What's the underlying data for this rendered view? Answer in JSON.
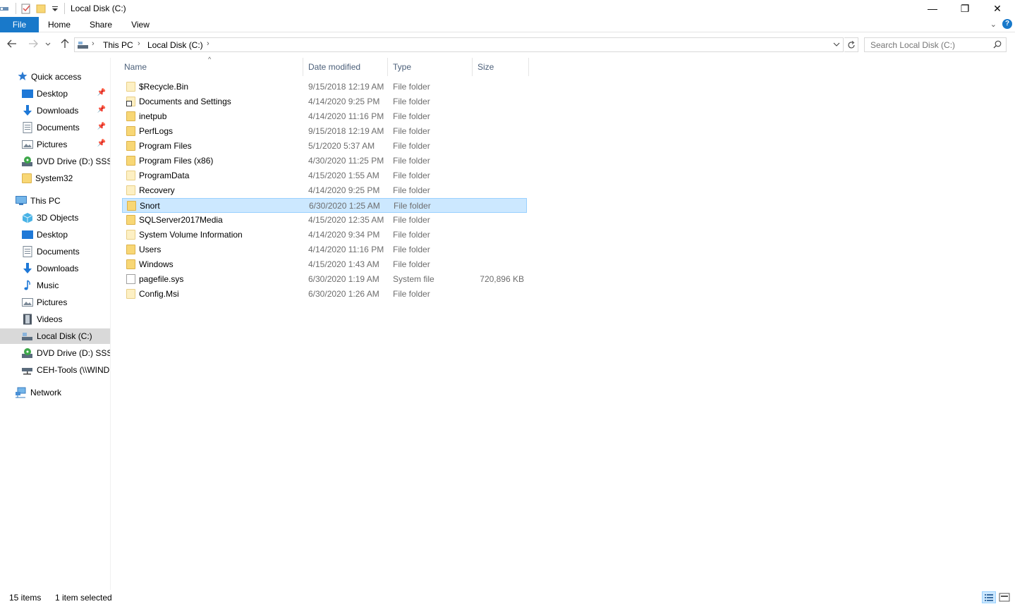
{
  "window": {
    "title": "Local Disk (C:)",
    "minimize_label": "—",
    "maximize_label": "❐",
    "close_label": "✕"
  },
  "ribbon": {
    "tabs": [
      {
        "label": "File"
      },
      {
        "label": "Home"
      },
      {
        "label": "Share"
      },
      {
        "label": "View"
      }
    ],
    "help_label": "?"
  },
  "address": {
    "crumbs": [
      "This PC",
      "Local Disk (C:)"
    ],
    "search_placeholder": "Search Local Disk (C:)"
  },
  "nav": {
    "quick_access": "Quick access",
    "quick_items": [
      {
        "label": "Desktop",
        "pinned": true
      },
      {
        "label": "Downloads",
        "pinned": true
      },
      {
        "label": "Documents",
        "pinned": true
      },
      {
        "label": "Pictures",
        "pinned": true
      },
      {
        "label": "DVD Drive (D:) SSS_X"
      },
      {
        "label": "System32"
      }
    ],
    "this_pc": "This PC",
    "pc_items": [
      {
        "label": "3D Objects"
      },
      {
        "label": "Desktop"
      },
      {
        "label": "Documents"
      },
      {
        "label": "Downloads"
      },
      {
        "label": "Music"
      },
      {
        "label": "Pictures"
      },
      {
        "label": "Videos"
      },
      {
        "label": "Local Disk (C:)",
        "selected": true
      },
      {
        "label": "DVD Drive (D:) SSS_X"
      },
      {
        "label": "CEH-Tools (\\\\WIND"
      }
    ],
    "network": "Network"
  },
  "columns": {
    "name": "Name",
    "date": "Date modified",
    "type": "Type",
    "size": "Size"
  },
  "files": [
    {
      "name": "$Recycle.Bin",
      "date": "9/15/2018 12:19 AM",
      "type": "File folder",
      "size": "",
      "icon": "folder-pale-icon"
    },
    {
      "name": "Documents and Settings",
      "date": "4/14/2020 9:25 PM",
      "type": "File folder",
      "size": "",
      "icon": "folder-shortcut-icon"
    },
    {
      "name": "inetpub",
      "date": "4/14/2020 11:16 PM",
      "type": "File folder",
      "size": "",
      "icon": "folder-icon"
    },
    {
      "name": "PerfLogs",
      "date": "9/15/2018 12:19 AM",
      "type": "File folder",
      "size": "",
      "icon": "folder-icon"
    },
    {
      "name": "Program Files",
      "date": "5/1/2020 5:37 AM",
      "type": "File folder",
      "size": "",
      "icon": "folder-icon"
    },
    {
      "name": "Program Files (x86)",
      "date": "4/30/2020 11:25 PM",
      "type": "File folder",
      "size": "",
      "icon": "folder-icon"
    },
    {
      "name": "ProgramData",
      "date": "4/15/2020 1:55 AM",
      "type": "File folder",
      "size": "",
      "icon": "folder-pale-icon"
    },
    {
      "name": "Recovery",
      "date": "4/14/2020 9:25 PM",
      "type": "File folder",
      "size": "",
      "icon": "folder-pale-icon"
    },
    {
      "name": "Snort",
      "date": "6/30/2020 1:25 AM",
      "type": "File folder",
      "size": "",
      "icon": "folder-icon",
      "selected": true
    },
    {
      "name": "SQLServer2017Media",
      "date": "4/15/2020 12:35 AM",
      "type": "File folder",
      "size": "",
      "icon": "folder-icon"
    },
    {
      "name": "System Volume Information",
      "date": "4/14/2020 9:34 PM",
      "type": "File folder",
      "size": "",
      "icon": "folder-pale-icon"
    },
    {
      "name": "Users",
      "date": "4/14/2020 11:16 PM",
      "type": "File folder",
      "size": "",
      "icon": "folder-icon"
    },
    {
      "name": "Windows",
      "date": "4/15/2020 1:43 AM",
      "type": "File folder",
      "size": "",
      "icon": "folder-icon"
    },
    {
      "name": "pagefile.sys",
      "date": "6/30/2020 1:19 AM",
      "type": "System file",
      "size": "720,896 KB",
      "icon": "file-icon"
    },
    {
      "name": "Config.Msi",
      "date": "6/30/2020 1:26 AM",
      "type": "File folder",
      "size": "",
      "icon": "folder-pale-icon"
    }
  ],
  "status": {
    "item_count": "15 items",
    "selection": "1 item selected"
  }
}
